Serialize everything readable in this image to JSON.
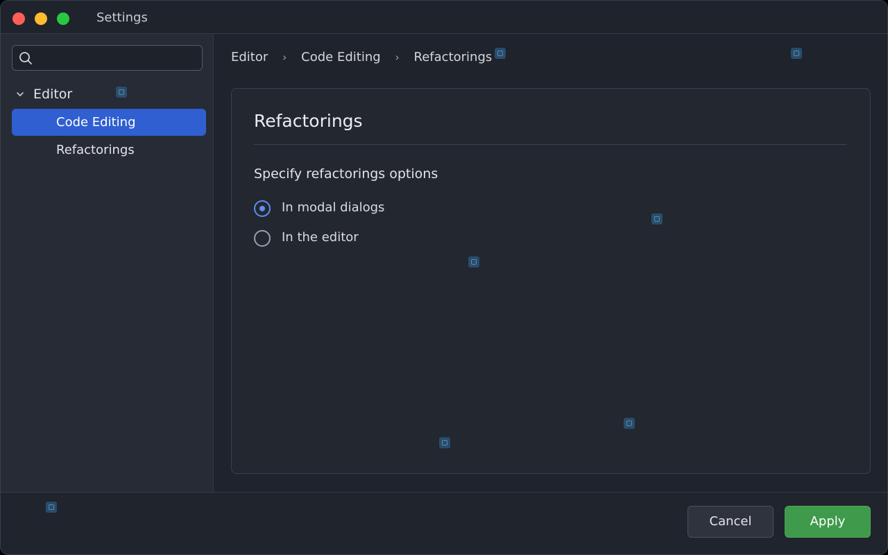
{
  "window": {
    "title": "Settings"
  },
  "sidebar": {
    "search": {
      "placeholder": "",
      "value": ""
    },
    "group": {
      "label": "Editor",
      "expanded": true
    },
    "items": [
      {
        "label": "Code Editing",
        "selected": true
      },
      {
        "label": "Refactorings",
        "selected": false
      }
    ]
  },
  "breadcrumb": {
    "items": [
      "Editor",
      "Code Editing",
      "Refactorings"
    ],
    "separator": "›"
  },
  "panel": {
    "title": "Refactorings",
    "section_label": "Specify refactorings options",
    "options": [
      {
        "label": "In modal dialogs",
        "checked": true
      },
      {
        "label": "In the editor",
        "checked": false
      }
    ]
  },
  "footer": {
    "cancel_label": "Cancel",
    "apply_label": "Apply"
  },
  "colors": {
    "accent": "#2f5fd0",
    "radio_accent": "#5d8ff0",
    "apply": "#3f9a4b",
    "background": "#1f232c",
    "sidebar": "#262b36"
  }
}
